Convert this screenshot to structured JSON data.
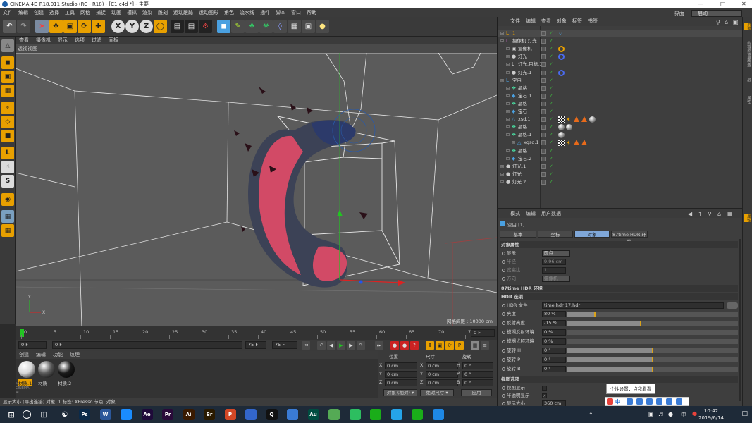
{
  "window": {
    "title": "CINEMA 4D R18.011 Studio (RC - R18) - [C1.c4d *] - 主要"
  },
  "menubar": {
    "items": [
      "文件",
      "编辑",
      "创建",
      "选择",
      "工具",
      "网格",
      "捕捉",
      "动画",
      "模拟",
      "渲染",
      "雕刻",
      "运动跟踪",
      "运动图形",
      "角色",
      "流水线",
      "插件",
      "脚本",
      "窗口",
      "帮助"
    ],
    "layout_label": "界面",
    "layout_value": "启动"
  },
  "viewport": {
    "menu": [
      "查看",
      "摄像机",
      "显示",
      "选项",
      "过滤",
      "面板"
    ],
    "title": "透视视图",
    "grid_info": "网格间距 : 10000 cm"
  },
  "timeline": {
    "ticks": [
      "0",
      "5",
      "10",
      "15",
      "20",
      "25",
      "30",
      "35",
      "40",
      "45",
      "50",
      "55",
      "60",
      "65",
      "70",
      "75"
    ],
    "end_frame_field": "0 F"
  },
  "transport": {
    "current_frame": "0 F",
    "start_frame": "0 F",
    "end_frame": "75 F",
    "end_field": "75 F"
  },
  "materials": {
    "menu": [
      "创建",
      "编辑",
      "功能",
      "纹理"
    ],
    "items": [
      {
        "label": "材质.1",
        "color": "#d8d8d8",
        "selected": true
      },
      {
        "label": "材质",
        "color": "#5a5a5a",
        "selected": false
      },
      {
        "label": "材质.2",
        "color": "#1a1a1a",
        "selected": false
      }
    ]
  },
  "coordinates": {
    "headers": [
      "位置",
      "尺寸",
      "旋转"
    ],
    "rows": [
      {
        "axis": "X",
        "pos": "0 cm",
        "size_axis": "X",
        "size": "0 cm",
        "rot_axis": "H",
        "rot": "0 °"
      },
      {
        "axis": "Y",
        "pos": "0 cm",
        "size_axis": "Y",
        "size": "0 cm",
        "rot_axis": "P",
        "rot": "0 °"
      },
      {
        "axis": "Z",
        "pos": "0 cm",
        "size_axis": "Z",
        "size": "0 cm",
        "rot_axis": "B",
        "rot": "0 °"
      }
    ],
    "mode_select": "对象 (相对)",
    "size_select": "绝对尺寸",
    "apply_button": "应用"
  },
  "status": {
    "text": "显示大小 (导出连接) 对象: 1 标签: XPresso 节点: 对象"
  },
  "object_manager": {
    "menu": [
      "文件",
      "编辑",
      "查看",
      "对象",
      "标签",
      "书签"
    ],
    "rows": [
      {
        "name": "1",
        "indent": 0,
        "icon": "null",
        "color": "#e8a000",
        "tags": [
          "dots"
        ]
      },
      {
        "name": "摄像机 灯光",
        "indent": 0,
        "icon": "null",
        "color": "#cc66cc",
        "tags": []
      },
      {
        "name": "摄像机",
        "indent": 1,
        "icon": "camera",
        "color": "#cccccc",
        "tags": [
          "target-orange"
        ]
      },
      {
        "name": "灯光",
        "indent": 1,
        "icon": "light",
        "color": "#cccccc",
        "tags": [
          "target-blue"
        ]
      },
      {
        "name": "灯光.目标.1",
        "indent": 1,
        "icon": "null",
        "color": "#cccccc",
        "tags": []
      },
      {
        "name": "灯光.1",
        "indent": 1,
        "icon": "light",
        "color": "#cccccc",
        "tags": [
          "target-blue"
        ]
      },
      {
        "name": "空白",
        "indent": 0,
        "icon": "null",
        "color": "#4aa0e0",
        "tags": []
      },
      {
        "name": "晶格",
        "indent": 1,
        "icon": "lattice",
        "color": "#4adba0",
        "tags": []
      },
      {
        "name": "宝石.1",
        "indent": 1,
        "icon": "gem",
        "color": "#4aa0e0",
        "tags": []
      },
      {
        "name": "晶格",
        "indent": 1,
        "icon": "lattice",
        "color": "#4adba0",
        "tags": []
      },
      {
        "name": "宝石",
        "indent": 1,
        "icon": "gem",
        "color": "#4aa0e0",
        "tags": []
      },
      {
        "name": "xsd.1",
        "indent": 1,
        "icon": "emitter",
        "color": "#4aa0e0",
        "tags": [
          "checker",
          "star",
          "triangle",
          "triangle",
          "ball"
        ]
      },
      {
        "name": "晶格",
        "indent": 1,
        "icon": "lattice",
        "color": "#4adba0",
        "tags": [
          "ball",
          "ball"
        ]
      },
      {
        "name": "晶格.1",
        "indent": 1,
        "icon": "lattice",
        "color": "#4adba0",
        "tags": [
          "ball"
        ]
      },
      {
        "name": "xgsd.1",
        "indent": 2,
        "icon": "emitter",
        "color": "#4aa0e0",
        "tags": [
          "checker",
          "star",
          "triangle",
          "triangle"
        ]
      },
      {
        "name": "晶格",
        "indent": 1,
        "icon": "lattice",
        "color": "#4adba0",
        "tags": []
      },
      {
        "name": "宝石.2",
        "indent": 1,
        "icon": "gem",
        "color": "#4aa0e0",
        "tags": []
      },
      {
        "name": "灯光.1",
        "indent": 0,
        "icon": "light",
        "color": "#cccccc",
        "tags": []
      },
      {
        "name": "灯光",
        "indent": 0,
        "icon": "light",
        "color": "#cccccc",
        "tags": []
      },
      {
        "name": "灯光.2",
        "indent": 0,
        "icon": "light",
        "color": "#cccccc",
        "tags": []
      }
    ]
  },
  "attribute_manager": {
    "menu": [
      "模式",
      "编辑",
      "用户数据"
    ],
    "object_title": "空白 [1]",
    "tabs": [
      "基本",
      "坐标",
      "对象",
      "87time HDR 环境"
    ],
    "active_tab": 2,
    "object_props_header": "对象属性",
    "display_label": "显示",
    "display_value": "圆点",
    "radius_label": "半径",
    "radius_value": "9.96 cm",
    "aspect_label": "宽高比",
    "aspect_value": "1",
    "orient_label": "方向",
    "orient_value": "摄像机",
    "hdr_section": "87time HDR 环境",
    "hdr_sub": "HDR 选项",
    "hdr_file_label": "HDR 文件",
    "hdr_file_value": "time hdr 17.hdr",
    "sliders": [
      {
        "label": "亮度",
        "value": "80 %",
        "frac": 0.16
      },
      {
        "label": "反射亮度",
        "value": "-15 %",
        "frac": 0.43
      },
      {
        "label": "模糊反射环境",
        "value": "0 %",
        "frac": 0
      },
      {
        "label": "模糊光照环境",
        "value": "0 %",
        "frac": 0
      },
      {
        "label": "旋转 H",
        "value": "0 °",
        "frac": 0.5
      },
      {
        "label": "旋转 P",
        "value": "0 °",
        "frac": 0.5
      },
      {
        "label": "旋转 B",
        "value": "0 °",
        "frac": 0.5
      }
    ],
    "view_section": "视图选项",
    "view_rows": [
      "视图显示",
      "半透明显示"
    ],
    "display_size_label": "显示大小",
    "display_size_value": "360 cm"
  },
  "right_rail": [
    "对象",
    "内容浏览器",
    "构造",
    "层",
    "属性"
  ],
  "tooltip": {
    "text": "个性设置，点我看看"
  },
  "taskbar": {
    "apps": [
      {
        "label": "Ps",
        "color": "#0a2a4a"
      },
      {
        "label": "W",
        "color": "#2b579a"
      },
      {
        "label": "",
        "color": "#1a8cff"
      },
      {
        "label": "Ae",
        "color": "#1f0a3a"
      },
      {
        "label": "Pr",
        "color": "#2a0a3a"
      },
      {
        "label": "Ai",
        "color": "#3a1a00"
      },
      {
        "label": "Br",
        "color": "#2a1a00"
      },
      {
        "label": "P",
        "color": "#d24726"
      },
      {
        "label": "",
        "color": "#3366cc"
      },
      {
        "label": "Q",
        "color": "#111111"
      },
      {
        "label": "",
        "color": "#3a7bd5"
      },
      {
        "label": "Au",
        "color": "#004d40"
      },
      {
        "label": "",
        "color": "#55aa55"
      },
      {
        "label": "",
        "color": "#2dbe60"
      },
      {
        "label": "",
        "color": "#1aad19"
      },
      {
        "label": "",
        "color": "#25a4e8"
      },
      {
        "label": "",
        "color": "#1aad19"
      },
      {
        "label": "",
        "color": "#1e88e5"
      }
    ],
    "time": "10:42",
    "date": "2019/6/14",
    "ime_label": "中"
  }
}
